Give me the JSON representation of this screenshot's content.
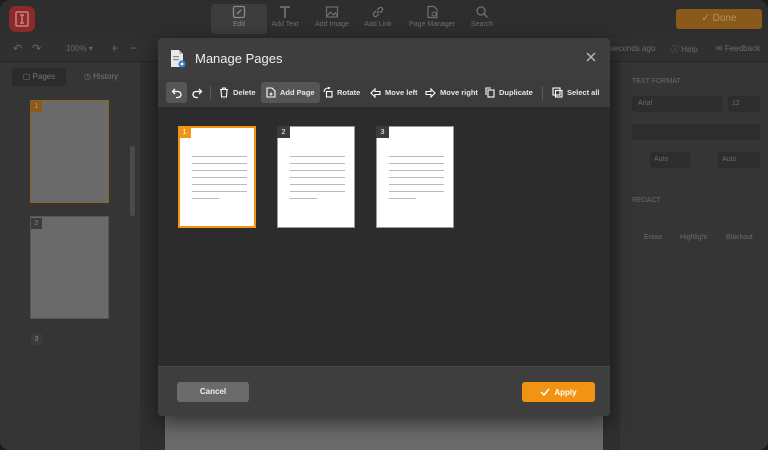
{
  "app": {
    "toolbar": {
      "edit": "Edit",
      "add_text": "Add Text",
      "add_image": "Add Image",
      "add_link": "Add Link",
      "page_manager": "Page Manager",
      "search": "Search"
    },
    "done_label": "Done",
    "zoom": "100%",
    "saved_text": "seconds ago",
    "help": "Help",
    "feedback": "Feedback",
    "sidebar_tabs": {
      "pages": "Pages",
      "history": "History"
    },
    "sidebar_page_numbers": [
      "1",
      "2",
      "3"
    ],
    "right_panel": {
      "text_format": "TEXT FORMAT",
      "font": "Arial",
      "font_size": "12",
      "line_spacing": "Auto",
      "char_spacing": "Auto",
      "redact": "REDACT",
      "erase": "Erase",
      "highlight": "Highlight",
      "blackout": "Blackout"
    }
  },
  "modal": {
    "title": "Manage Pages",
    "toolbar": {
      "delete": "Delete",
      "add_page": "Add Page",
      "rotate": "Rotate",
      "move_left": "Move left",
      "move_right": "Move right",
      "duplicate": "Duplicate",
      "select_all": "Select all"
    },
    "pages": [
      {
        "number": "1",
        "selected": true
      },
      {
        "number": "2",
        "selected": false
      },
      {
        "number": "3",
        "selected": false
      }
    ],
    "cancel_label": "Cancel",
    "apply_label": "Apply"
  },
  "colors": {
    "accent": "#f39314",
    "modal_bg": "#3c3c3c",
    "content_bg": "#2c2c2c"
  }
}
